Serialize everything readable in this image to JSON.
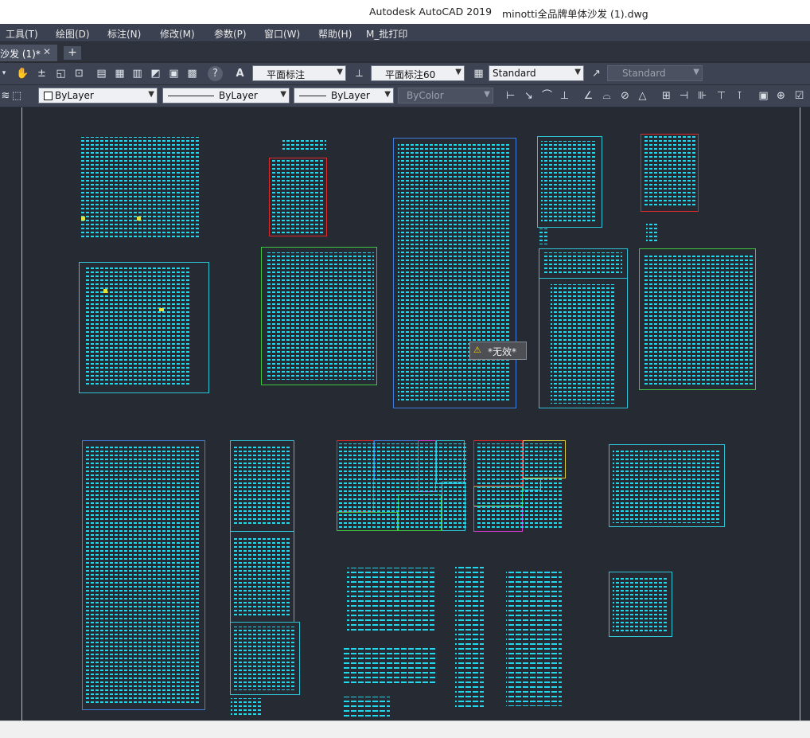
{
  "window": {
    "app_title": "Autodesk AutoCAD 2019",
    "file_title": "minotti全品牌单体沙发 (1).dwg"
  },
  "menu": [
    "工具(T)",
    "绘图(D)",
    "标注(N)",
    "修改(M)",
    "参数(P)",
    "窗口(W)",
    "帮助(H)",
    "M_批打印"
  ],
  "tabs": {
    "active": "沙发 (1)*",
    "close_glyph": "✕",
    "new_glyph": "+"
  },
  "toolbar1": {
    "dim_style": "平面标注",
    "dim_style2": "平面标注60",
    "table_style": "Standard",
    "multileader_style": "Standard"
  },
  "toolbar2": {
    "color": "ByLayer",
    "linetype": "ByLayer",
    "lineweight": "ByLayer",
    "plot_style": "ByColor"
  },
  "tooltip": {
    "text": "*无效*"
  },
  "icons": {
    "pan": "pan-hand-icon",
    "zoom_realtime": "zoom-realtime-icon",
    "zoom_window": "zoom-window-icon",
    "zoom_previous": "zoom-previous-icon",
    "properties": "properties-icon",
    "design_center": "design-center-icon",
    "tool_palettes": "tool-palettes-icon",
    "sheet_set": "sheet-set-icon",
    "markup": "markup-icon",
    "calculator": "calculator-icon",
    "help": "help-icon",
    "text_style": "text-style-icon",
    "dim_style": "dim-style-icon",
    "table_style": "table-style-icon",
    "mleader_style": "mleader-style-icon"
  },
  "colors": {
    "canvas_bg": "#252a33",
    "cyan": "#22d8ee",
    "frame_cyan": "#2fc3d6",
    "frame_blue": "#3f7fe0",
    "frame_red": "#e02a2a",
    "frame_green": "#3fc53f",
    "frame_magenta": "#d23ad2",
    "frame_yellow": "#e0d040",
    "limits_yellow": "#d4c83a"
  }
}
